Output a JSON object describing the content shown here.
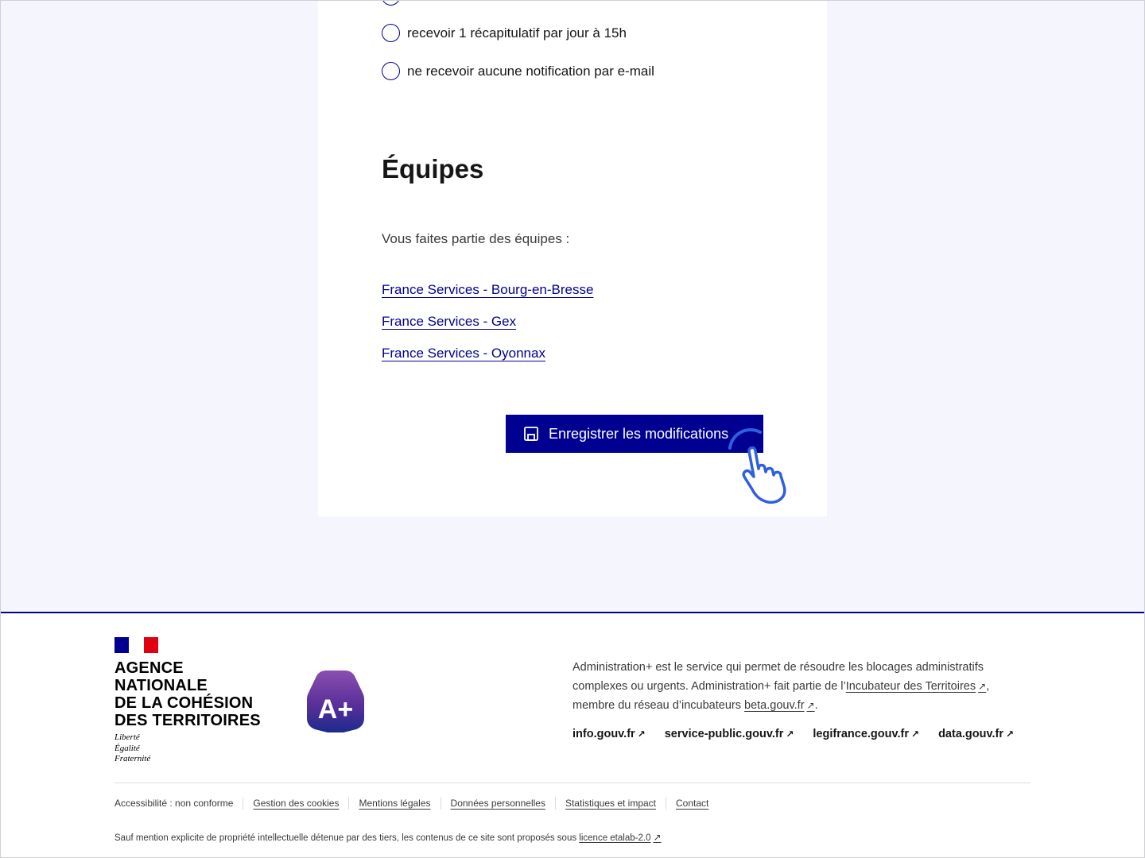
{
  "notifications": {
    "options": [
      {
        "label": "recevoir 1 récapitulatif par jour à 15h"
      },
      {
        "label": "ne recevoir aucune notification par e-mail"
      }
    ]
  },
  "teams": {
    "title": "Équipes",
    "intro": "Vous faites partie des équipes :",
    "links": [
      "France Services - Bourg-en-Bresse",
      "France Services - Gex",
      "France Services - Oyonnax"
    ]
  },
  "save_button": {
    "label": "Enregistrer les modifications",
    "icon": "save-icon"
  },
  "footer": {
    "logo": {
      "name_lines": [
        "AGENCE",
        "NATIONALE",
        "DE LA COHÉSION",
        "DES TERRITOIRES"
      ],
      "motto": [
        "Liberté",
        "Égalité",
        "Fraternité"
      ]
    },
    "aplus_logo_text": "A+",
    "description_part1": "Administration+ est le service qui permet de résoudre les blocages administratifs complexes ou urgents. Administration+ fait partie de l’",
    "incubator_link": "Incubateur des Territoires",
    "description_part2": ", membre du réseau d’incubateurs ",
    "beta_link": "beta.gouv.fr",
    "description_part3": ".",
    "gov_links": [
      "info.gouv.fr",
      "service-public.gouv.fr",
      "legifrance.gouv.fr",
      "data.gouv.fr"
    ],
    "accessibility": "Accessibilité : non conforme",
    "bottom_links": [
      "Gestion des cookies",
      "Mentions légales",
      "Données personnelles",
      "Statistiques et impact",
      "Contact"
    ],
    "license_text": "Sauf mention explicite de propriété intellectuelle détenue par des tiers, les contenus de ce site sont proposés sous ",
    "license_link": "licence etalab-2.0"
  },
  "colors": {
    "primary": "#000091",
    "page_background": "#f5f5fe",
    "flag_blue": "#000091",
    "flag_red": "#e1000f",
    "aplus_purple": "#6a3fa0",
    "pointer_blue": "#2f5fe0"
  }
}
